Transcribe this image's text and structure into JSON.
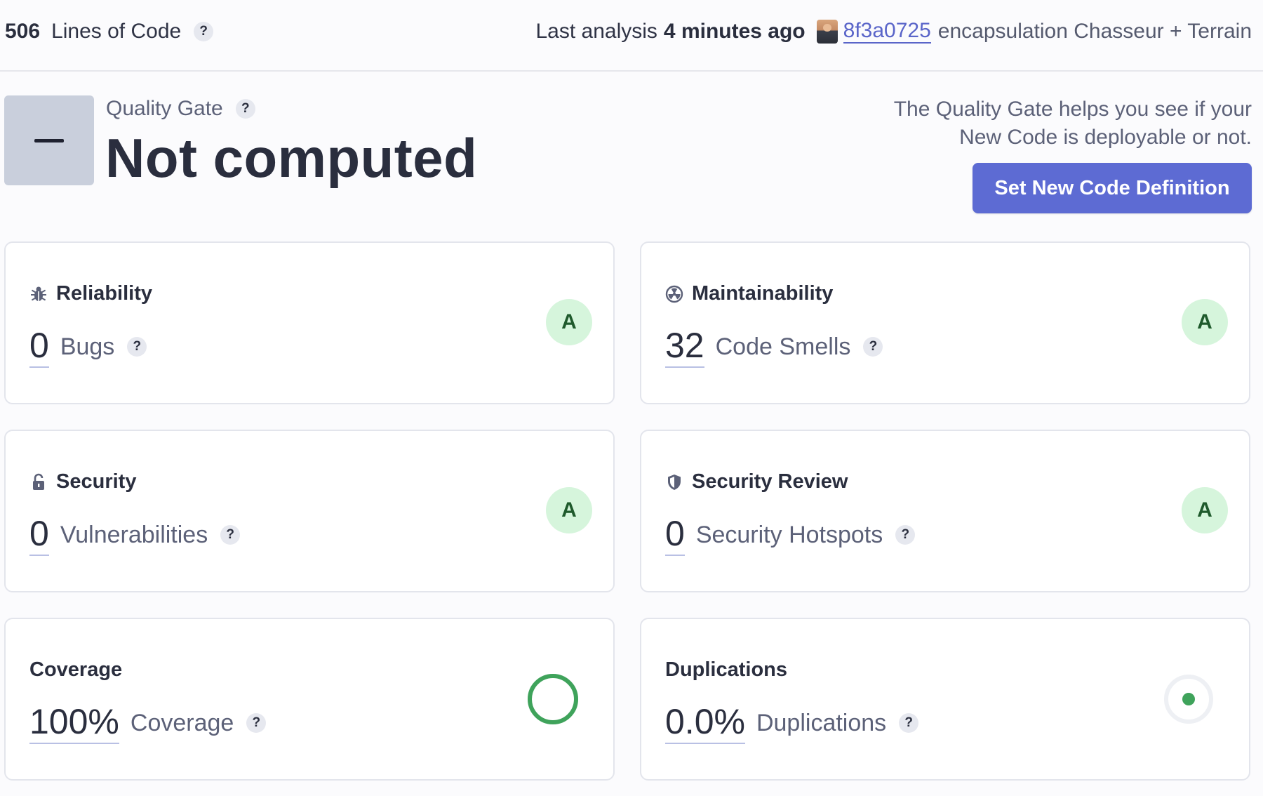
{
  "topbar": {
    "loc_value": "506",
    "loc_label": "Lines of Code",
    "help_glyph": "?",
    "analysis_lead": "Last analysis",
    "analysis_time": "4 minutes ago",
    "commit_hash": "8f3a0725",
    "commit_message": "encapsulation Chasseur + Terrain"
  },
  "quality_gate": {
    "label": "Quality Gate",
    "status": "Not computed",
    "desc_line1": "The Quality Gate helps you see if your",
    "desc_line2": "New Code is deployable or not.",
    "button_label": "Set New Code Definition"
  },
  "cards": {
    "reliability": {
      "title": "Reliability",
      "icon": "bug-icon",
      "value": "0",
      "label": "Bugs",
      "rating": "A"
    },
    "maintainability": {
      "title": "Maintainability",
      "icon": "radiation-icon",
      "value": "32",
      "label": "Code Smells",
      "rating": "A"
    },
    "security": {
      "title": "Security",
      "icon": "lock-icon",
      "value": "0",
      "label": "Vulnerabilities",
      "rating": "A"
    },
    "security_review": {
      "title": "Security Review",
      "icon": "shield-icon",
      "value": "0",
      "label": "Security Hotspots",
      "rating": "A"
    },
    "coverage": {
      "title": "Coverage",
      "value": "100%",
      "label": "Coverage",
      "fraction": 1.0
    },
    "duplications": {
      "title": "Duplications",
      "value": "0.0%",
      "label": "Duplications",
      "fraction": 0.0
    }
  },
  "colors": {
    "accent": "#5d6bd3",
    "rating_bg": "#d6f5dc",
    "rating_text": "#1f5a2c",
    "coverage_green": "#3fa35b"
  }
}
